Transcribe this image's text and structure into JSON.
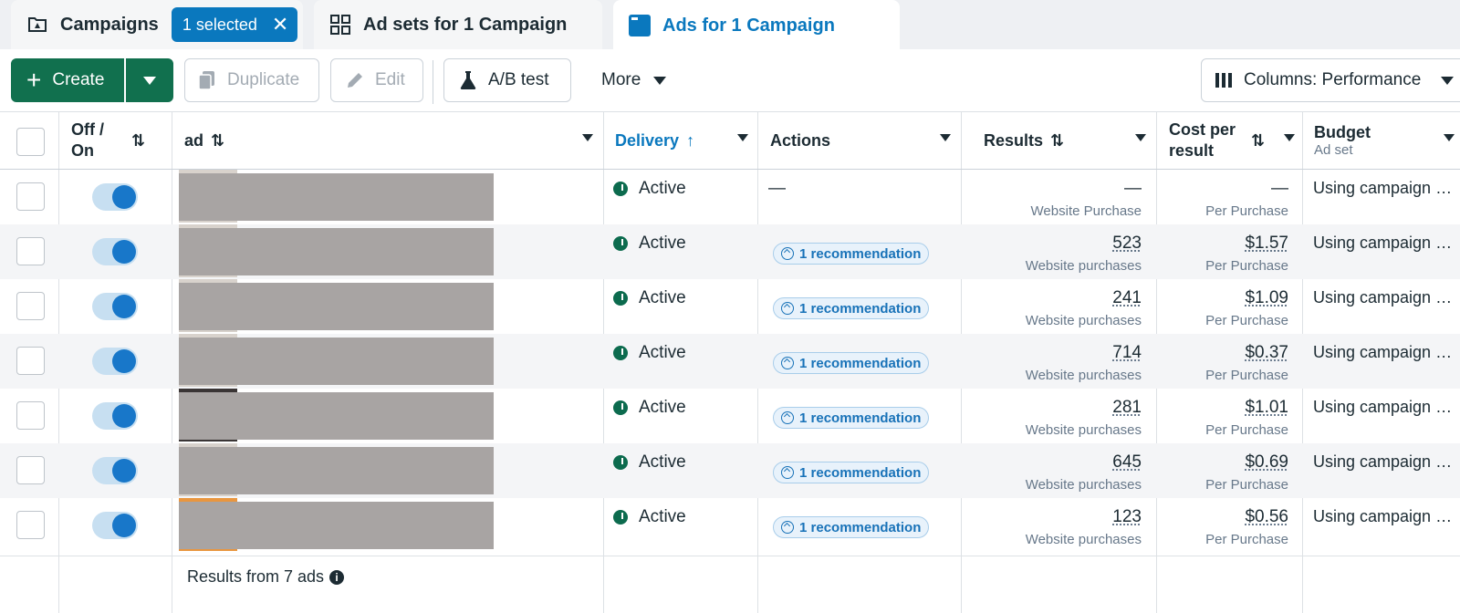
{
  "tabs": {
    "campaigns": {
      "label": "Campaigns",
      "selected_pill": "1 selected",
      "close": "✕"
    },
    "adsets": {
      "label": "Ad sets for 1 Campaign"
    },
    "ads": {
      "label": "Ads for 1 Campaign"
    }
  },
  "toolbar": {
    "create_label": "Create",
    "duplicate_label": "Duplicate",
    "edit_label": "Edit",
    "ab_test_label": "A/B test",
    "more_label": "More",
    "columns_label": "Columns: Performance"
  },
  "columns": {
    "offon": "Off / On",
    "ad": "ad",
    "delivery": "Delivery",
    "actions": "Actions",
    "results": "Results",
    "cost_per_result": "Cost per result",
    "budget": "Budget",
    "budget_sub": "Ad set"
  },
  "rows": [
    {
      "enabled": true,
      "delivery": "Active",
      "actions": "—",
      "results": "—",
      "results_sub": "Website Purchase",
      "cpr": "—",
      "cpr_sub": "Per Purchase",
      "budget": "Using campaign budget"
    },
    {
      "enabled": true,
      "delivery": "Active",
      "actions": "1 recommendation",
      "results": "523",
      "results_sub": "Website purchases",
      "cpr": "$1.57",
      "cpr_sub": "Per Purchase",
      "budget": "Using campaign budget"
    },
    {
      "enabled": true,
      "delivery": "Active",
      "actions": "1 recommendation",
      "results": "241",
      "results_sub": "Website purchases",
      "cpr": "$1.09",
      "cpr_sub": "Per Purchase",
      "budget": "Using campaign budget"
    },
    {
      "enabled": true,
      "delivery": "Active",
      "actions": "1 recommendation",
      "results": "714",
      "results_sub": "Website purchases",
      "cpr": "$0.37",
      "cpr_sub": "Per Purchase",
      "budget": "Using campaign budget"
    },
    {
      "enabled": true,
      "delivery": "Active",
      "actions": "1 recommendation",
      "results": "281",
      "results_sub": "Website purchases",
      "cpr": "$1.01",
      "cpr_sub": "Per Purchase",
      "budget": "Using campaign budget"
    },
    {
      "enabled": true,
      "delivery": "Active",
      "actions": "1 recommendation",
      "results": "645",
      "results_sub": "Website purchases",
      "cpr": "$0.69",
      "cpr_sub": "Per Purchase",
      "budget": "Using campaign budget"
    },
    {
      "enabled": true,
      "delivery": "Active",
      "actions": "1 recommendation",
      "results": "123",
      "results_sub": "Website purchases",
      "cpr": "$0.56",
      "cpr_sub": "Per Purchase",
      "budget": "Using campaign budget"
    }
  ],
  "footer": {
    "summary": "Results from 7 ads"
  },
  "colors": {
    "accent": "#0a78be",
    "create_green": "#11704e",
    "active_green": "#0c6b4e"
  }
}
